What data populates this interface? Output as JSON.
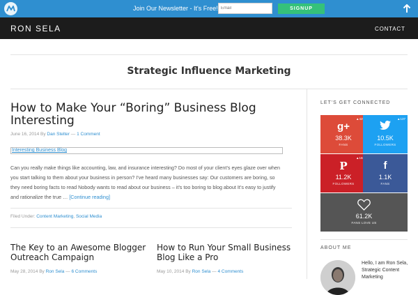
{
  "newsletter": {
    "text": "Join Our Newsletter - It's Free!",
    "email_placeholder": "Email",
    "signup_label": "SIGNUP"
  },
  "header": {
    "site_title": "RON SELA",
    "nav_contact": "CONTACT"
  },
  "page": {
    "title": "Strategic Influence Marketing"
  },
  "main_post": {
    "title": "How to Make Your “Boring” Business Blog Interesting",
    "date": "June 16, 2014",
    "by": "By",
    "author": "Dan Stelter",
    "sep": "—",
    "comments": "1 Comment",
    "image_alt": "Interesting Business Blog",
    "excerpt": "Can you really make things like accounting, law, and insurance interesting? Do most of your client’s eyes glaze over when you start talking to them about your business in person? I’ve heard many businesses say: Our customers are boring, so they need boring facts to read Nobody wants to read about our business – it’s too boring to blog about It’s easy to justify and rationalize the true …",
    "read_more": "[Continue reading]",
    "filed_under": "Filed Under:",
    "cat1": "Content Marketing",
    "cat_sep": ",",
    "cat2": "Social Media"
  },
  "posts": [
    {
      "title": "The Key to an Awesome Blogger Outreach Campaign",
      "date": "May 28, 2014",
      "by": "By",
      "author": "Ron Sela",
      "sep": "—",
      "comments": "6 Comments"
    },
    {
      "title": "How to Run Your Small Business Blog Like a Pro",
      "date": "May 10, 2014",
      "by": "By",
      "author": "Ron Sela",
      "sep": "—",
      "comments": "4 Comments"
    }
  ],
  "sidebar": {
    "connect_title": "LET'S GET CONNECTED",
    "tiles": [
      {
        "icon": "g+",
        "icon_name": "google-plus-icon",
        "badge": "▲425",
        "count": "38.3K",
        "label": "FANS",
        "color": "#dd4b39"
      },
      {
        "icon": "twitter",
        "icon_name": "twitter-icon",
        "badge": "▲137",
        "count": "10.5K",
        "label": "FOLLOWERS",
        "color": "#1da1f2"
      },
      {
        "icon": "P",
        "icon_name": "pinterest-icon",
        "badge": "▲168",
        "count": "11.2K",
        "label": "FOLLOWERS",
        "color": "#cb2027"
      },
      {
        "icon": "f",
        "icon_name": "facebook-icon",
        "badge": "",
        "count": "1.1K",
        "label": "FANS",
        "color": "#3b5998"
      },
      {
        "icon": "heart",
        "icon_name": "heart-icon",
        "badge": "",
        "count": "61.2K",
        "label": "FANS LOVE US",
        "color": "#555555"
      }
    ],
    "about_title": "ABOUT ME",
    "about_text": "Hello, I am Ron Sela, Strategic Content Marketing"
  }
}
